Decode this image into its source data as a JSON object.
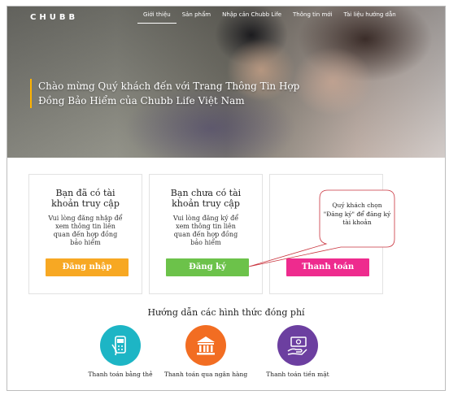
{
  "header": {
    "logo": "CHUBB",
    "nav": [
      "Giới thiệu",
      "Sản phẩm",
      "Nhập cản Chubb Life",
      "Thông tin mới",
      "Tài liệu hướng dẫn"
    ]
  },
  "hero": {
    "title": "Chào mừng Quý khách đến với Trang Thông Tin Hợp Đồng Bảo Hiểm của Chubb Life Việt Nam"
  },
  "cards": {
    "login": {
      "title": "Bạn đã có tài khoản truy cập",
      "desc": "Vui lòng đăng nhập để xem thông tin liên quan đến hợp đồng bảo hiểm",
      "button": "Đăng nhập"
    },
    "register": {
      "title": "Bạn chưa có tài khoản truy cập",
      "desc": "Vui lòng đăng ký để xem thông tin liên quan đến hợp đồng bảo hiểm",
      "button": "Đăng ký"
    },
    "pay": {
      "button": "Thanh toán"
    }
  },
  "callout": {
    "text": "Quý khách chọn \"Đăng ký\" để đăng ký tài khoản"
  },
  "guide": {
    "title": "Hướng dẫn các hình thức đóng phí",
    "methods": [
      {
        "label": "Thanh toán bằng thẻ",
        "icon": "card-terminal-icon",
        "color": "#1db5c5"
      },
      {
        "label": "Thanh toán qua ngân hàng",
        "icon": "bank-icon",
        "color": "#f26d22"
      },
      {
        "label": "Thanh toán tiền mặt",
        "icon": "cash-icon",
        "color": "#6c3fa0"
      }
    ]
  },
  "colors": {
    "login": "#f7a823",
    "register": "#6cc24a",
    "pay": "#ee2b8e",
    "accent": "#ffb300"
  }
}
